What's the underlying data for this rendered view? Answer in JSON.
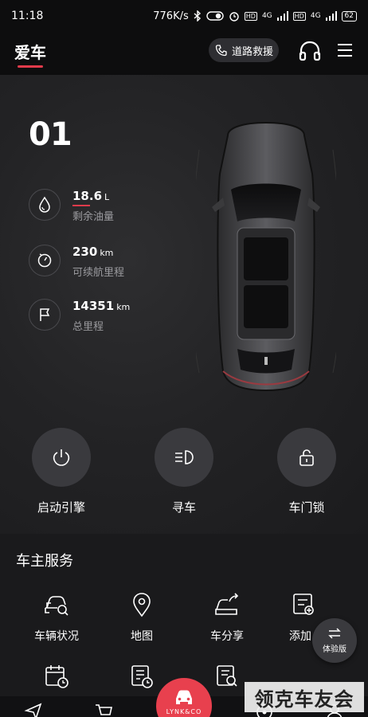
{
  "status_bar": {
    "time": "11:18",
    "speed": "776K/s",
    "battery": "62",
    "signal1": "4G",
    "signal2": "4G"
  },
  "header": {
    "tab": "爱车",
    "rescue_label": "道路救援"
  },
  "vehicle": {
    "model_name": "01",
    "stats": [
      {
        "value": "18.6",
        "unit": "L",
        "label": "剩余油量",
        "icon": "fuel-drop-icon"
      },
      {
        "value": "230",
        "unit": "km",
        "label": "可续航里程",
        "icon": "range-gauge-icon"
      },
      {
        "value": "14351",
        "unit": "km",
        "label": "总里程",
        "icon": "flag-icon"
      }
    ]
  },
  "actions": [
    {
      "label": "启动引擎",
      "icon": "power-icon"
    },
    {
      "label": "寻车",
      "icon": "headlight-icon"
    },
    {
      "label": "车门锁",
      "icon": "lock-icon"
    }
  ],
  "services": {
    "title": "车主服务",
    "items": [
      {
        "label": "车辆状况",
        "icon": "car-search-icon"
      },
      {
        "label": "地图",
        "icon": "map-pin-icon"
      },
      {
        "label": "车分享",
        "icon": "car-share-icon"
      },
      {
        "label": "添加",
        "icon": "add-document-icon"
      }
    ],
    "row2": [
      {
        "icon": "calendar-clock-icon"
      },
      {
        "icon": "document-clock-icon"
      },
      {
        "icon": "document-search-icon"
      }
    ]
  },
  "experience_button": {
    "label": "体验版"
  },
  "bottom_nav": {
    "brand": "LYNK&CO"
  },
  "watermark": "领克车友会",
  "colors": {
    "accent": "#e23b4b",
    "background": "#1a1a1c",
    "button": "#3a3a3e"
  }
}
